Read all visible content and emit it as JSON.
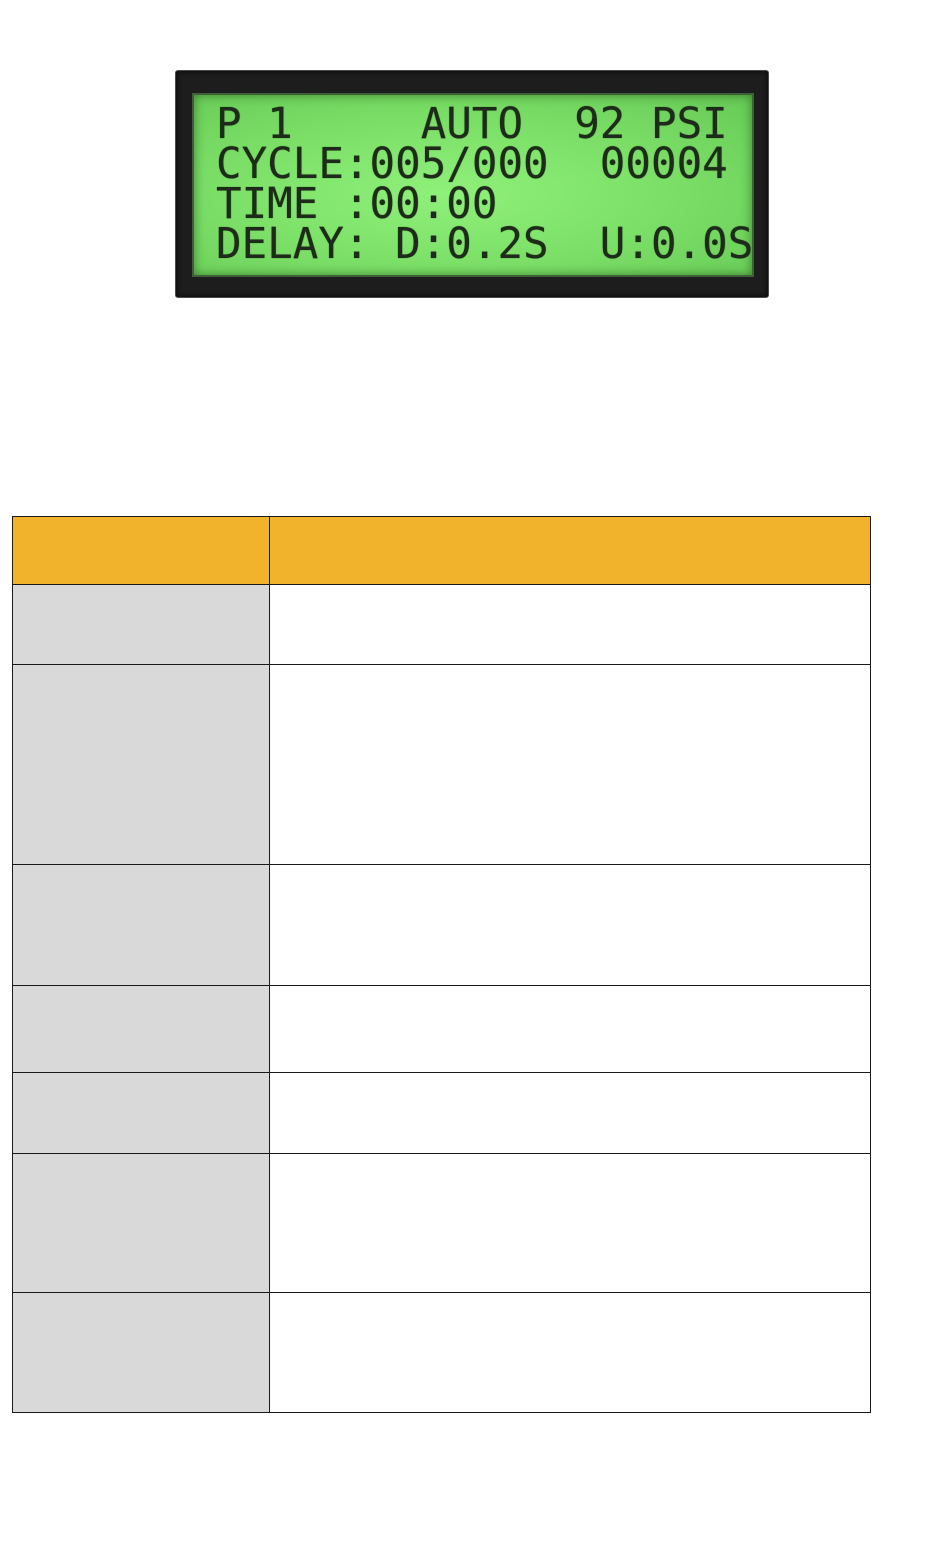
{
  "lcd": {
    "lines": [
      "P 1     AUTO  92 PSI",
      "CYCLE:005/000  00004",
      "TIME :00:00",
      "DELAY: D:0.2S  U:0.0S"
    ],
    "colors": {
      "backlight": "#7ee26a",
      "text": "#1e2a1a",
      "bezel": "#1c1d1c"
    }
  },
  "table": {
    "colors": {
      "header": "#f0b32b",
      "label_column": "#d9d9d9",
      "value_column": "#ffffff"
    },
    "header": [
      "",
      ""
    ],
    "rows": [
      [
        "",
        ""
      ],
      [
        "",
        ""
      ],
      [
        "",
        ""
      ],
      [
        "",
        ""
      ],
      [
        "",
        ""
      ],
      [
        "",
        ""
      ],
      [
        "",
        ""
      ]
    ]
  }
}
